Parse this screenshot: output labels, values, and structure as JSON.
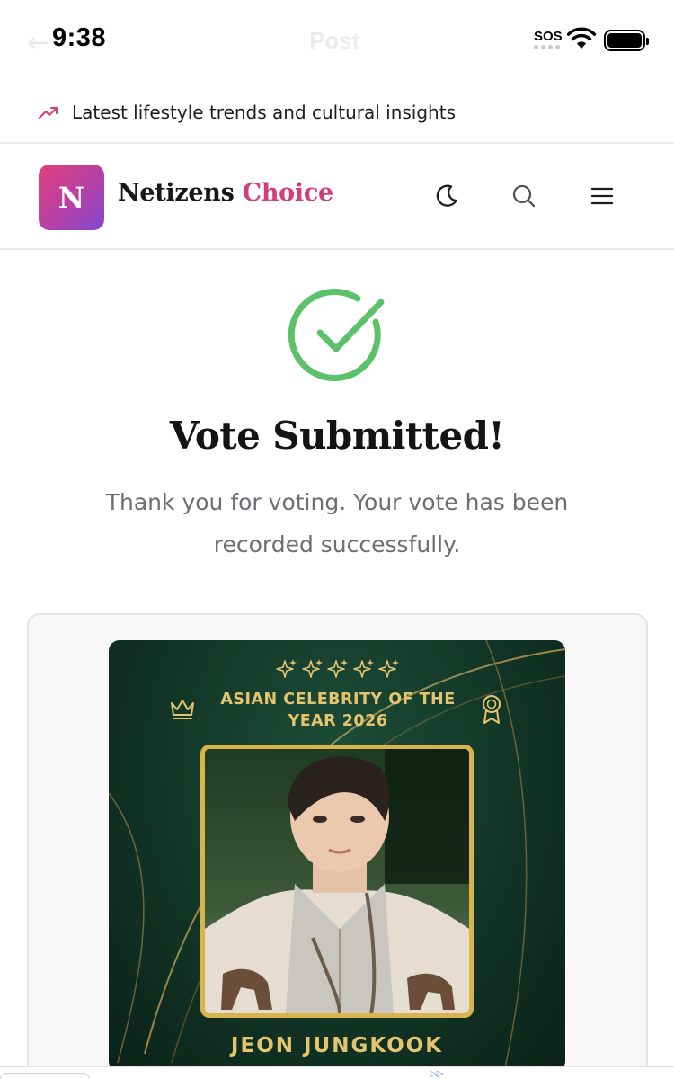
{
  "status_bar": {
    "time": "9:38",
    "ghost_title": "Post",
    "sos": "SOS"
  },
  "trend_banner": {
    "text": "Latest lifestyle trends and cultural insights",
    "icon": "trending-up-icon"
  },
  "header": {
    "logo_letter": "N",
    "brand_name": "Netizens",
    "brand_accent": "Choice",
    "icons": [
      "moon-icon",
      "search-icon",
      "menu-icon"
    ]
  },
  "confirmation": {
    "title": "Vote Submitted!",
    "message": "Thank you for voting. Your vote has been recorded successfully.",
    "icon": "check-circle-icon",
    "icon_color": "#5cc26a"
  },
  "award_card": {
    "award_title": "ASIAN CELEBRITY OF THE YEAR 2026",
    "nominee": "JEON JUNGKOOK",
    "accent_color": "#e4c46c",
    "star_count": 5
  },
  "colors": {
    "brand_accent": "#d23f78",
    "logo_gradient_start": "#e0407a",
    "logo_gradient_end": "#8048d2",
    "poster_bg": "#123526"
  }
}
